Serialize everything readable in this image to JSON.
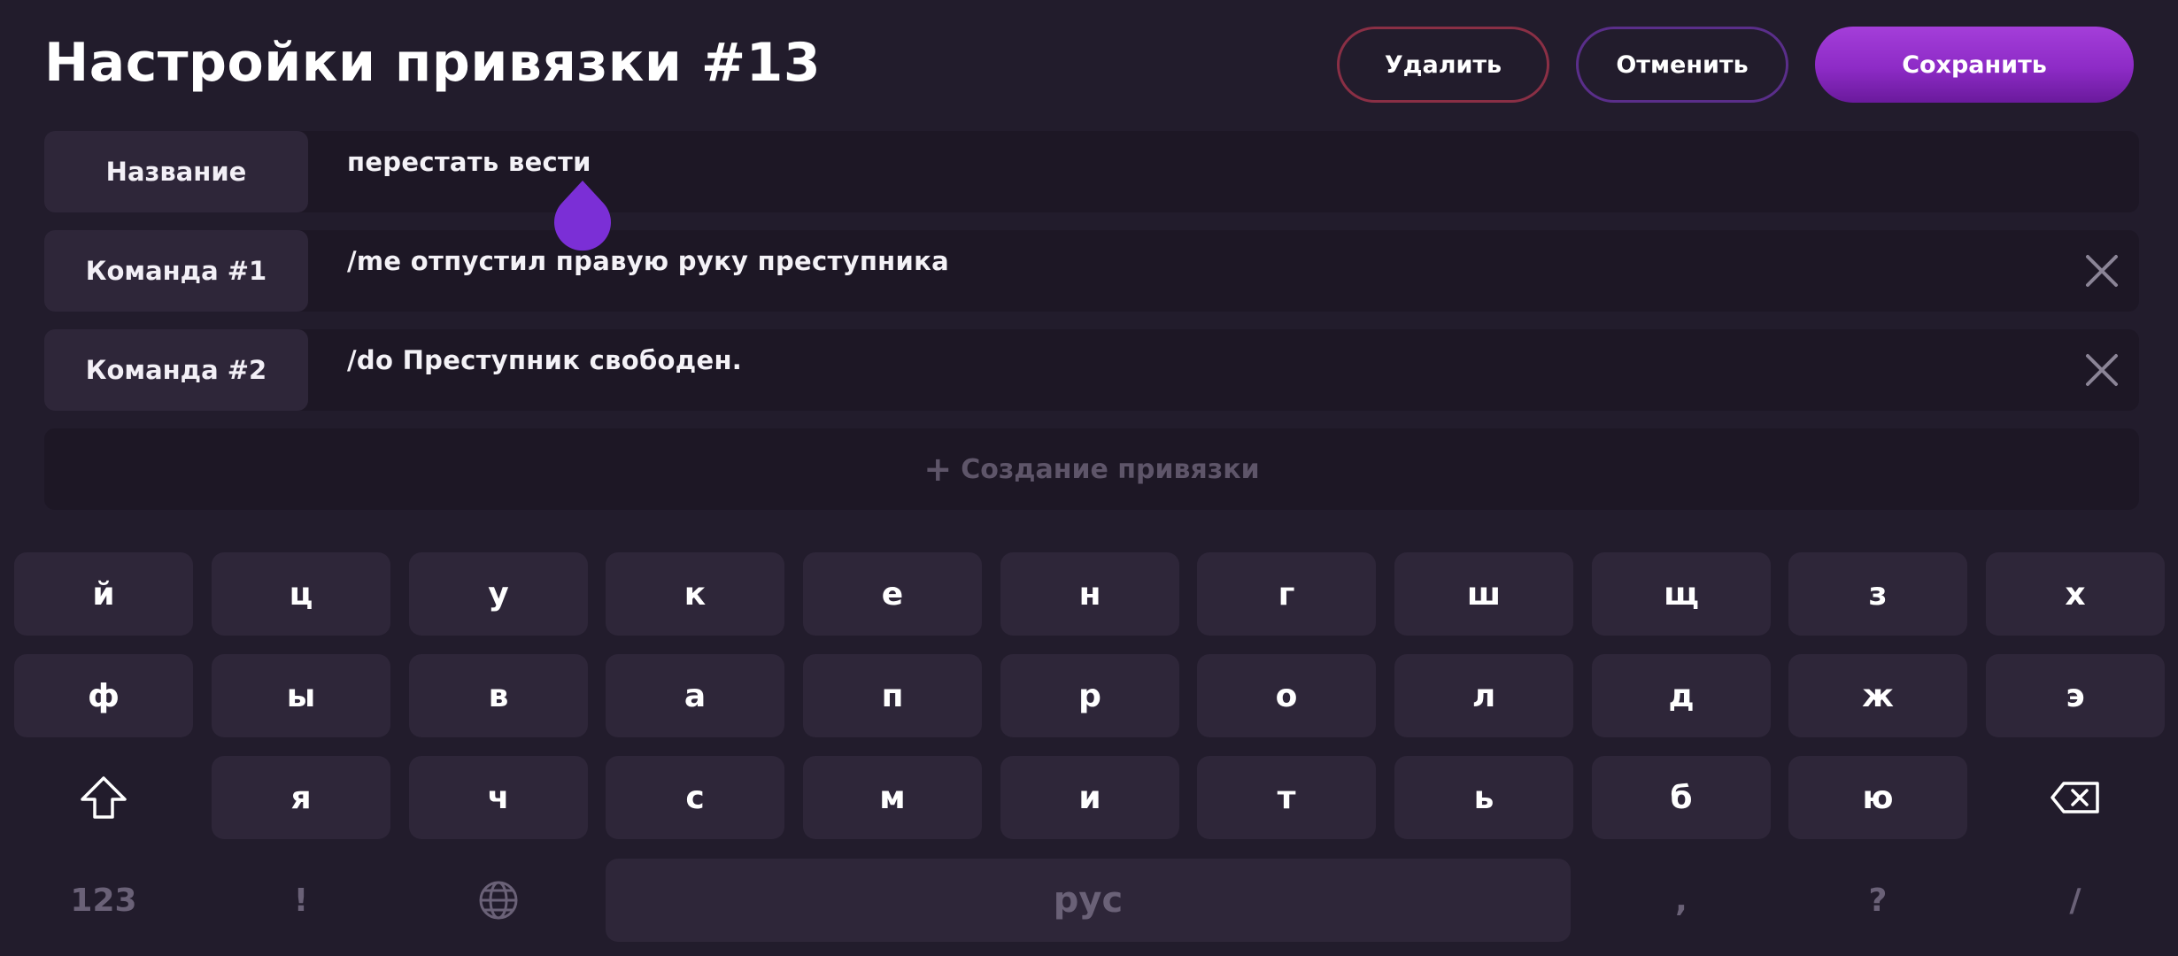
{
  "header": {
    "title": "Настройки привязки #13",
    "delete_label": "Удалить",
    "cancel_label": "Отменить",
    "save_label": "Сохранить"
  },
  "rows": [
    {
      "label": "Название",
      "value": "перестать вести"
    },
    {
      "label": "Команда #1",
      "value": "/me отпустил правую руку преступника"
    },
    {
      "label": "Команда #2",
      "value": "/do Преступник свободен."
    }
  ],
  "add_row": {
    "plus": "+",
    "label": "Создание привязки"
  },
  "keyboard": {
    "row1": [
      "й",
      "ц",
      "у",
      "к",
      "е",
      "н",
      "г",
      "ш",
      "щ",
      "з",
      "х"
    ],
    "row2": [
      "ф",
      "ы",
      "в",
      "а",
      "п",
      "р",
      "о",
      "л",
      "д",
      "ж",
      "э"
    ],
    "row3": [
      "я",
      "ч",
      "с",
      "м",
      "и",
      "т",
      "ь",
      "б",
      "ю"
    ],
    "numbers_label": "123",
    "exclaim": "!",
    "space_label": "рус",
    "comma": ",",
    "question": "?",
    "slash": "/",
    "icons": {
      "shift": "shift-icon",
      "backspace": "backspace-icon",
      "language": "globe-icon"
    }
  },
  "colors": {
    "background": "#221c2c",
    "key": "#2e2639",
    "field": "#1d1725",
    "accent": "#8d2bc6",
    "delete_border": "#8a2f45",
    "cancel_border": "#5a2e8a"
  }
}
